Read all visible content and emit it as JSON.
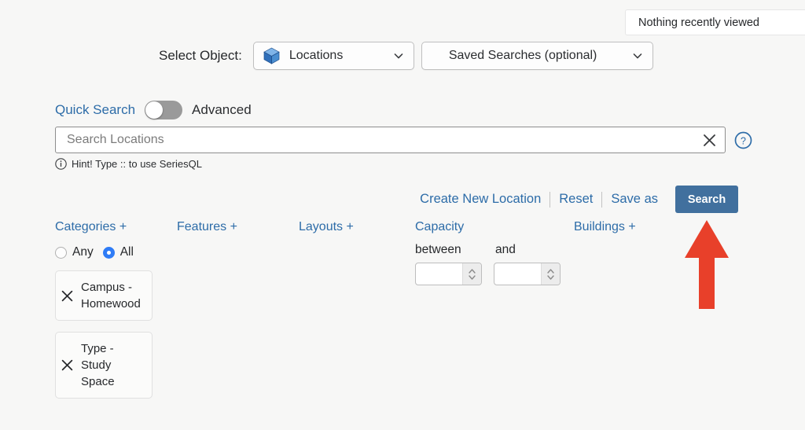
{
  "recent": {
    "text": "Nothing recently viewed"
  },
  "select_row": {
    "label": "Select Object:",
    "object_dropdown": {
      "value": "Locations",
      "icon": "cube-icon",
      "chevron": "chevron-down-icon"
    },
    "saved_searches_dropdown": {
      "value": "Saved Searches (optional)",
      "chevron": "chevron-down-icon"
    }
  },
  "mode_toggle": {
    "quick_label": "Quick Search",
    "advanced_label": "Advanced",
    "state": "quick",
    "active_color": "#2d6ca8"
  },
  "search": {
    "placeholder": "Search Locations",
    "value": "",
    "clear_icon": "close-x-icon",
    "help_icon": "question-circle-icon",
    "hint_icon": "info-circle-icon",
    "hint": "Hint! Type :: to use SeriesQL"
  },
  "actions": {
    "create": "Create New Location",
    "reset": "Reset",
    "save_as": "Save as",
    "search_button": "Search",
    "search_button_color": "#41709e"
  },
  "filters": {
    "categories": {
      "heading": "Categories +",
      "match_any": "Any",
      "match_all": "All",
      "selected": "All",
      "chips": [
        {
          "label": "Campus - Homewood",
          "remove_icon": "close-x-icon"
        },
        {
          "label": "Type - Study Space",
          "remove_icon": "close-x-icon"
        }
      ]
    },
    "features": {
      "heading": "Features +"
    },
    "layouts": {
      "heading": "Layouts +"
    },
    "capacity": {
      "heading": "Capacity",
      "between_label": "between",
      "and_label": "and",
      "min_value": "",
      "max_value": ""
    },
    "buildings": {
      "heading": "Buildings +"
    }
  },
  "annotation": {
    "arrow": "up-arrow-annotation",
    "color": "#e8402a",
    "points_at": "Search"
  }
}
